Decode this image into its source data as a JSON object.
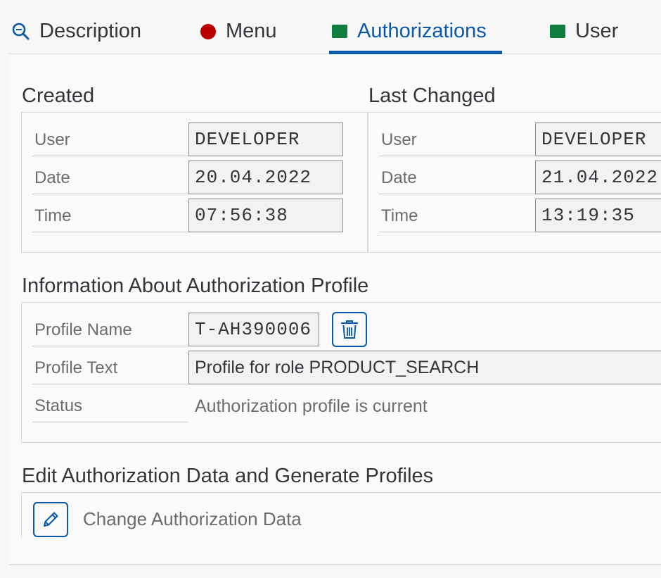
{
  "tabs": [
    {
      "label": "Description",
      "icon": "search-icon"
    },
    {
      "label": "Menu",
      "icon": "red-circle-icon"
    },
    {
      "label": "Authorizations",
      "icon": "green-square-icon",
      "active": true
    },
    {
      "label": "User",
      "icon": "green-square-icon"
    }
  ],
  "created": {
    "title": "Created",
    "user_label": "User",
    "user_value": "DEVELOPER",
    "date_label": "Date",
    "date_value": "20.04.2022",
    "time_label": "Time",
    "time_value": "07:56:38"
  },
  "last_changed": {
    "title": "Last Changed",
    "user_label": "User",
    "user_value": "DEVELOPER",
    "date_label": "Date",
    "date_value": "21.04.2022",
    "time_label": "Time",
    "time_value": "13:19:35"
  },
  "profile_info": {
    "title": "Information About Authorization Profile",
    "name_label": "Profile Name",
    "name_value": "T-AH390006",
    "text_label": "Profile Text",
    "text_value": "Profile for role PRODUCT_SEARCH",
    "status_label": "Status",
    "status_value": "Authorization profile is current"
  },
  "edit_section": {
    "title": "Edit Authorization Data and Generate Profiles",
    "change_label": "Change Authorization Data"
  },
  "colors": {
    "accent": "#0a58a8",
    "status_red": "#bb0000",
    "status_green": "#107e3e"
  }
}
